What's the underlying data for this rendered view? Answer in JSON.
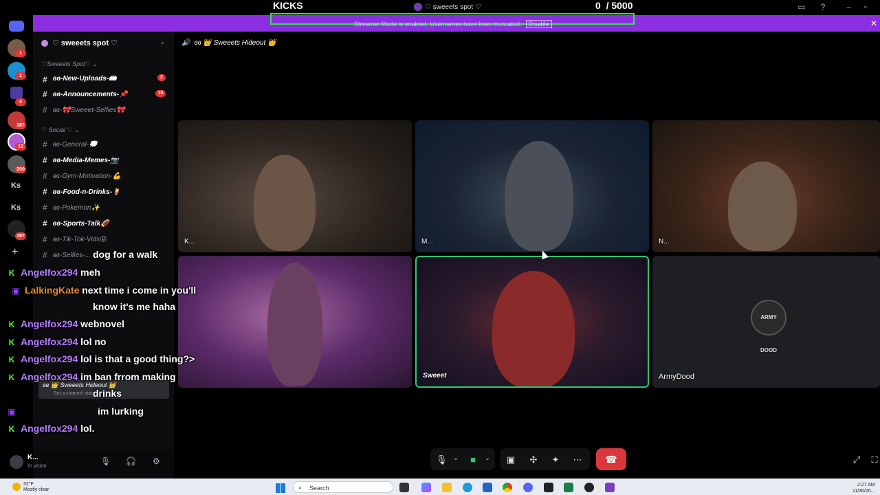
{
  "top": {
    "kicks_label": "KICKS",
    "server_name": "♡ sweeets spot ♡",
    "goal_current": "0",
    "goal_total": "/ 5000"
  },
  "banner": {
    "text": "Streamer Mode is enabled. Usernames have been truncated.",
    "disable_label": "Disable",
    "color": "#8c2fe0"
  },
  "rail": {
    "badges": [
      "1",
      "1",
      "4",
      "187",
      "12",
      "200",
      "197"
    ],
    "text_items": [
      "Ks",
      "Ks"
    ]
  },
  "sidebar": {
    "server_header": "♡ sweeets spot ♡",
    "categories": [
      {
        "label": "♡Sweeets Spot♡ ⌄"
      },
      {
        "label": "♡ Social ♡ ⌄"
      }
    ],
    "channels": [
      {
        "label": "ɞɞ-New-Uploads-📾",
        "unread": true,
        "badge": "2"
      },
      {
        "label": "ɞɞ-Announcements-📌",
        "unread": true,
        "badge": "10"
      },
      {
        "label": "ɞɞ-🎀Sweeet-Selfies🎀",
        "unread": false,
        "badge": ""
      },
      {
        "label": "ɞɞ-General-💭",
        "unread": false,
        "badge": ""
      },
      {
        "label": "ɞɞ-Media-Memes-📷",
        "unread": true,
        "badge": ""
      },
      {
        "label": "ɞɞ-Gym-Motivation-💪",
        "unread": false,
        "badge": ""
      },
      {
        "label": "ɞɞ-Food-n-Drinks-🍹",
        "unread": true,
        "badge": ""
      },
      {
        "label": "ɞɞ-Pokemon✨",
        "unread": false,
        "badge": ""
      },
      {
        "label": "ɞɞ-Sports-Talk🏈",
        "unread": true,
        "badge": ""
      },
      {
        "label": "ɞɞ-Tik-Tok-Vids😝",
        "unread": false,
        "badge": ""
      },
      {
        "label": "ɞɞ-Selfies-...",
        "unread": false,
        "badge": ""
      }
    ],
    "voice_channel": "ɞɞ 👑 Sweeets Hideout 👑",
    "voice_sub": "Set a channel status"
  },
  "user": {
    "name": "K...",
    "status": "In voice"
  },
  "chat": [
    {
      "platform": "",
      "nick": "",
      "msg": "dog for a walk"
    },
    {
      "platform": "kick",
      "nick": "Angelfox294",
      "msg": "meh"
    },
    {
      "platform": "twitch",
      "nick": "LalkingKate",
      "msg": "next time i come in you'll"
    },
    {
      "platform": "",
      "nick": "",
      "msg": "know it's me haha"
    },
    {
      "platform": "kick",
      "nick": "Angelfox294",
      "msg": "webnovel"
    },
    {
      "platform": "kick",
      "nick": "Angelfox294",
      "msg": "lol no"
    },
    {
      "platform": "kick",
      "nick": "Angelfox294",
      "msg": "lol is that a good thing?>"
    },
    {
      "platform": "kick",
      "nick": "Angelfox294",
      "msg": "im ban frrom making"
    },
    {
      "platform": "",
      "nick": "",
      "msg": "drinks"
    },
    {
      "platform": "twitch",
      "nick": "",
      "msg": "im lurking"
    },
    {
      "platform": "kick",
      "nick": "Angelfox294",
      "msg": "lol."
    }
  ],
  "call": {
    "channel_title": "ɞɞ 👑 Sweeets Hideout 👑",
    "tiles": [
      {
        "label": "K..."
      },
      {
        "label": "M..."
      },
      {
        "label": "N..."
      },
      {
        "label": ""
      },
      {
        "label": "Sweeet"
      },
      {
        "label": "ArmyDood"
      }
    ],
    "avatar_text": "ARMY DOOD"
  },
  "taskbar": {
    "weather_temp": "32°F",
    "weather_desc": "Mostly clear",
    "search_placeholder": "Search",
    "time": "2:27 AM",
    "date": "11/30/20..."
  }
}
